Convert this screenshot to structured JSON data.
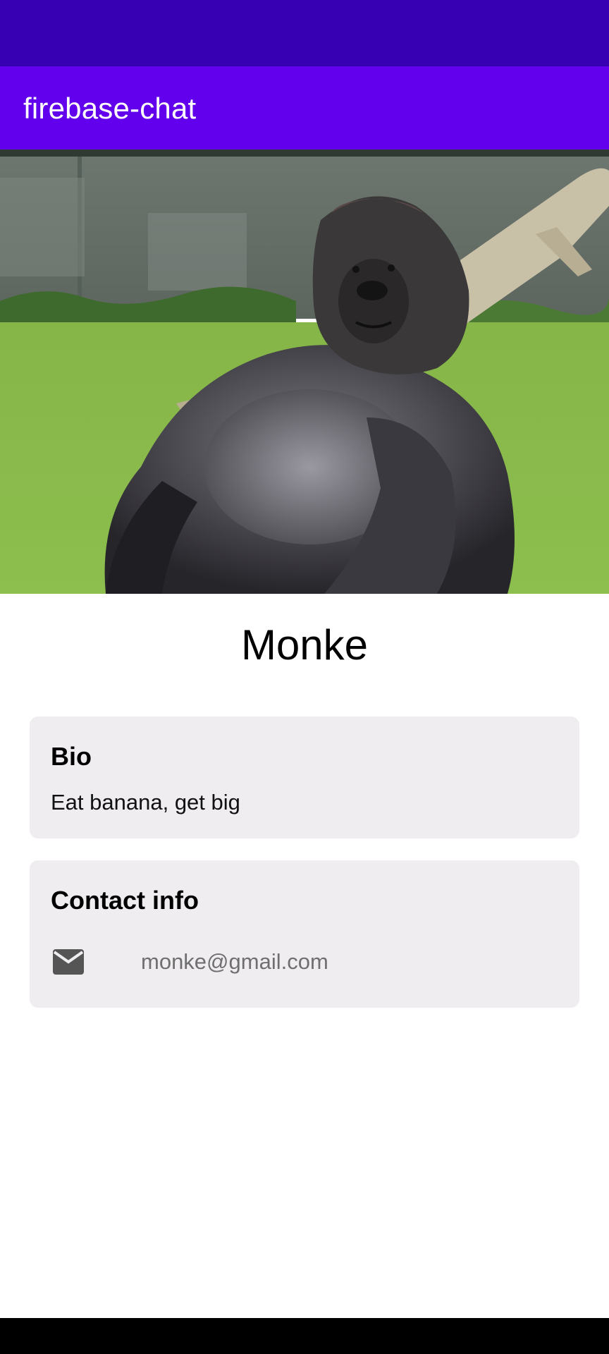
{
  "app": {
    "title": "firebase-chat"
  },
  "hero": {
    "image": "gorilla-photo"
  },
  "profile": {
    "name": "Monke"
  },
  "bio": {
    "heading": "Bio",
    "text": "Eat banana, get big"
  },
  "contact": {
    "heading": "Contact info",
    "items": [
      {
        "icon": "mail-icon",
        "value": "monke@gmail.com"
      }
    ]
  },
  "colors": {
    "status_bar": "#3700b3",
    "app_bar": "#6200ee",
    "card_background": "#efedf0",
    "nav_bar": "#000000"
  }
}
